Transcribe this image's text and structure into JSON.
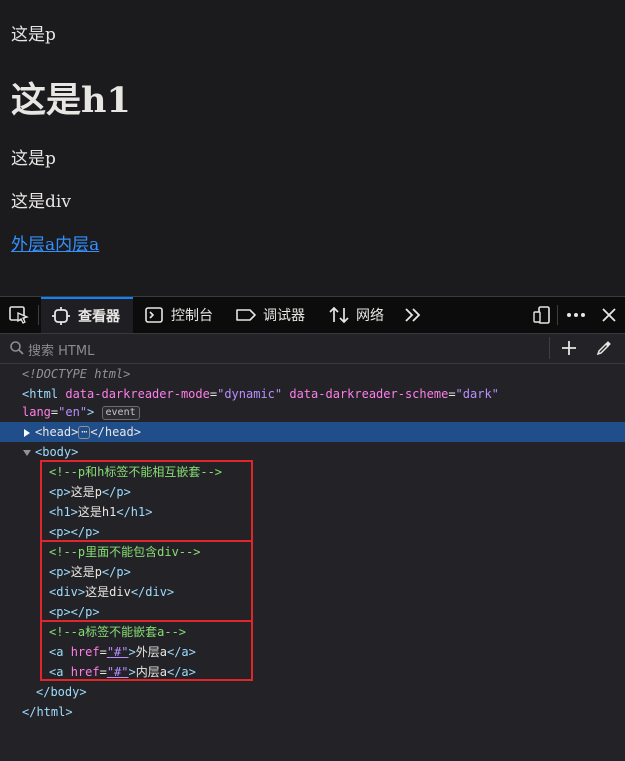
{
  "page": {
    "p1": "这是p",
    "h1": "这是h1",
    "p2": "这是p",
    "div1": "这是div",
    "link_outer": "外层a",
    "link_inner": "内层a"
  },
  "devtools": {
    "tabs": {
      "inspector": "查看器",
      "console": "控制台",
      "debugger": "调试器",
      "network": "网络"
    },
    "search_placeholder": "搜索 HTML",
    "code": {
      "doctype": "<!DOCTYPE html>",
      "html_open_prefix": "<html ",
      "attr_mode": "data-darkreader-mode",
      "val_mode": "\"dynamic\"",
      "attr_scheme": "data-darkreader-scheme",
      "val_scheme": "\"dark\"",
      "attr_lang": "lang",
      "val_lang": "\"en\"",
      "event_badge": "event",
      "head_open": "<head>",
      "head_close": "</head>",
      "ellipsis": "⋯",
      "body_open": "<body>",
      "comment1": "<!--p和h标签不能相互嵌套-->",
      "l_p_open": "<p>",
      "l_p_text": "这是p",
      "l_p_close": "</p>",
      "l_h1_open": "<h1>",
      "l_h1_text": "这是h1",
      "l_h1_close": "</h1>",
      "l_pp": "<p></p>",
      "comment2": "<!--p里面不能包含div-->",
      "l_p2_text": "这是p",
      "l_div_open": "<div>",
      "l_div_text": "这是div",
      "l_div_close": "</div>",
      "comment3": "<!--a标签不能嵌套a-->",
      "a_open": "<a ",
      "a_attr": "href",
      "a_val": "\"#\"",
      "a_text1": "外层a",
      "a_text2": "内层a",
      "a_close": "</a>",
      "body_close": "</body>",
      "html_close": "</html>"
    }
  },
  "colors": {
    "accent": "#0a84ff",
    "selection": "#204e8a",
    "highlight_box": "#e0262b",
    "link": "#3391ff"
  }
}
